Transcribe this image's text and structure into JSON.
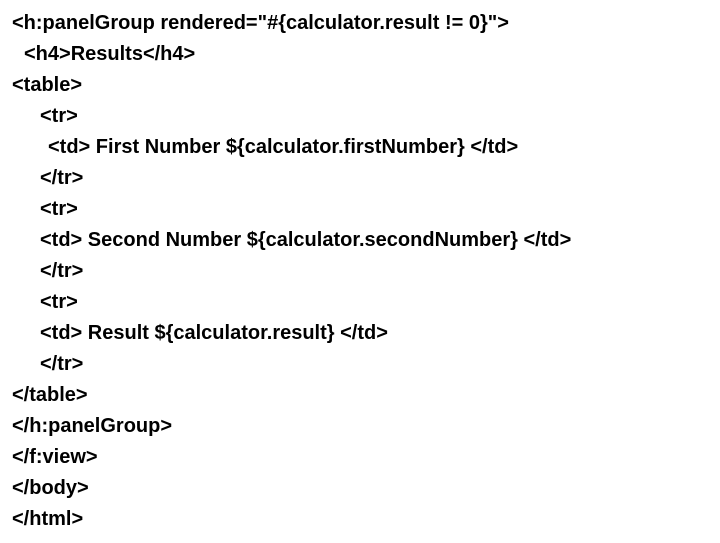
{
  "lines": [
    {
      "cls": "",
      "text": "<h:panelGroup rendered=\"#{calculator.result != 0}\">"
    },
    {
      "cls": "i1",
      "text": "<h4>Results</h4>"
    },
    {
      "cls": "",
      "text": "<table>"
    },
    {
      "cls": "i2",
      "text": "<tr>"
    },
    {
      "cls": "i3",
      "text": "<td> First Number ${calculator.firstNumber} </td>"
    },
    {
      "cls": "i2",
      "text": "</tr>"
    },
    {
      "cls": "i2",
      "text": "<tr>"
    },
    {
      "cls": "i2",
      "text": "<td> Second Number ${calculator.secondNumber} </td>"
    },
    {
      "cls": "i2",
      "text": "</tr>"
    },
    {
      "cls": "i2",
      "text": "<tr>"
    },
    {
      "cls": "i2",
      "text": "<td> Result ${calculator.result} </td>"
    },
    {
      "cls": "i2",
      "text": "</tr>"
    },
    {
      "cls": "",
      "text": "</table>"
    },
    {
      "cls": "",
      "text": "</h:panelGroup>"
    },
    {
      "cls": "",
      "text": "</f:view>"
    },
    {
      "cls": "",
      "text": "</body>"
    },
    {
      "cls": "",
      "text": "</html>"
    }
  ]
}
